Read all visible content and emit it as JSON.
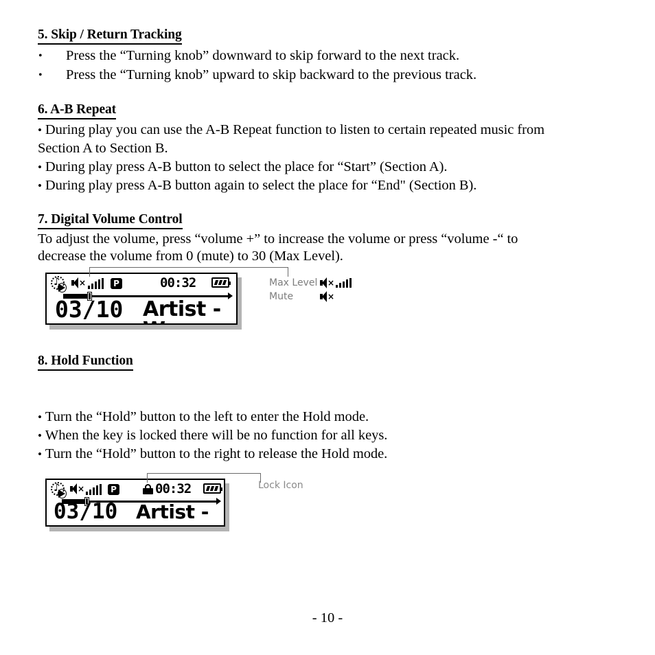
{
  "document": {
    "page_number": "- 10 -"
  },
  "sections": {
    "skip_return": {
      "heading": "5. Skip / Return Tracking",
      "bullets": [
        "Press the “Turning knob” downward to skip forward to the next track.",
        "Press the “Turning knob” upward to skip backward to the previous track."
      ]
    },
    "ab_repeat": {
      "heading": "6. A-B Repeat",
      "para1_line1": "During play you can use the A-B Repeat function to listen to certain repeated music from",
      "para1_line2": "Section A to Section B.",
      "bullet2": "During play press A-B button to select the place for “Start” (Section A).",
      "bullet3": "During play press A-B button again to select the place for “End\" (Section B)."
    },
    "volume": {
      "heading": "7. Digital Volume Control",
      "line1": "To adjust the volume, press  “volume +” to increase the volume or press “volume -“ to",
      "line2": "decrease the volume from 0 (mute) to 30 (Max Level)."
    },
    "hold": {
      "heading": "8. Hold Function",
      "bullets": [
        "Turn the “Hold” button to the left to enter the Hold mode.",
        "When the key is locked there will be no function for all keys.",
        "Turn the “Hold” button to the right to release the Hold mode."
      ]
    }
  },
  "figures": {
    "volume_display": {
      "lcd": {
        "note_glyph": "♪",
        "mute_wave": "×",
        "mode_badge": "P",
        "time": "00:32",
        "track_number": "03/10",
        "separator": "",
        "title": "Artist - Wa",
        "signal_bars": 5,
        "battery_bars": 3,
        "progress_percent": 25
      },
      "annotations": {
        "max_level_label": "Max Level",
        "mute_label": "Mute"
      }
    },
    "hold_display": {
      "lcd": {
        "note_glyph": "♪",
        "mute_wave": "×",
        "mode_badge": "P",
        "time": "00:32",
        "track_number": "03/10",
        "title": "Artist - Wa",
        "signal_bars": 5,
        "battery_bars": 3,
        "progress_percent": 25
      },
      "annotations": {
        "lock_label": "Lock Icon"
      }
    }
  },
  "colors": {
    "ink": "#000000",
    "paper": "#ffffff",
    "shadow": "#b4b4b4",
    "annotation": "#7d7d7d"
  }
}
